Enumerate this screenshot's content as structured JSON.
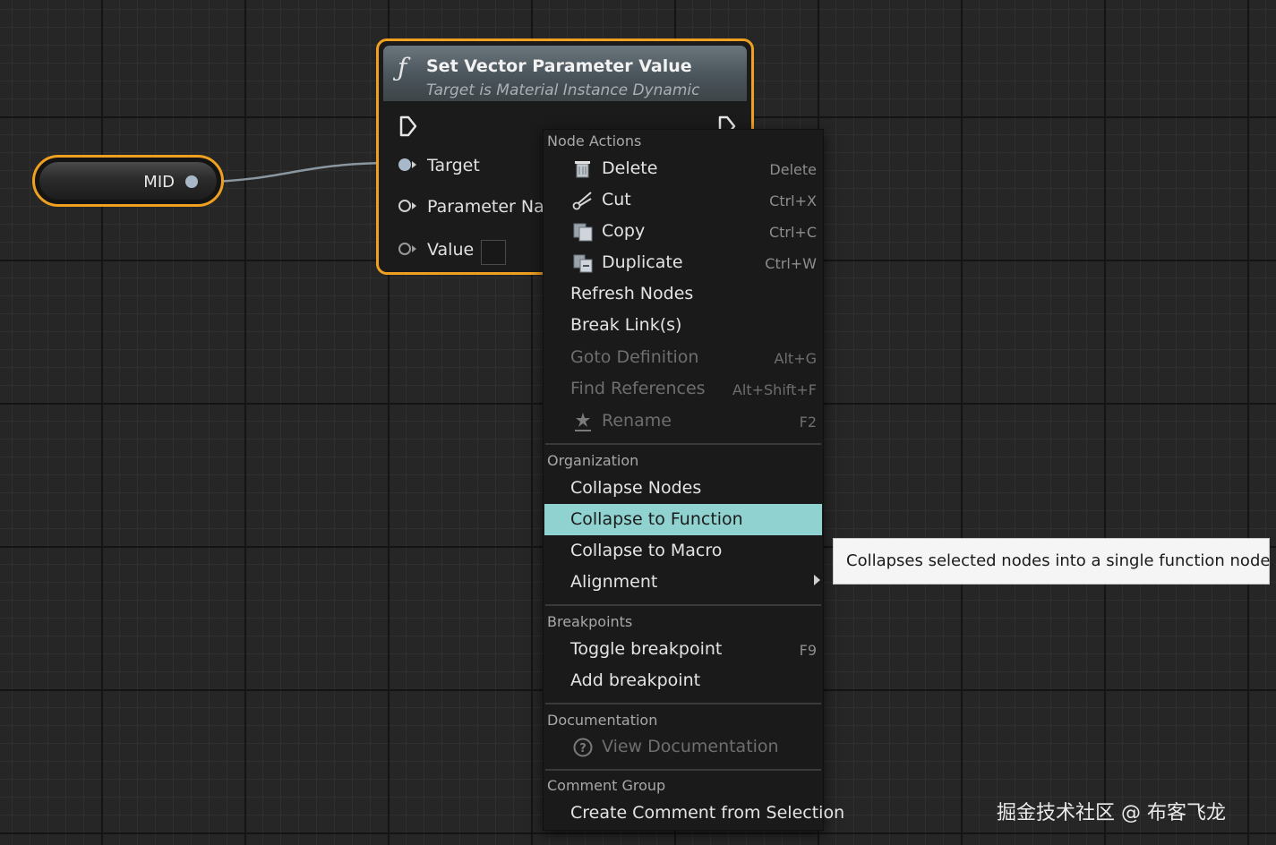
{
  "colors": {
    "selection_outline": "#f0a020",
    "menu_highlight": "#8fd2d0",
    "menu_background": "#1a1a1a",
    "tooltip_background": "#f5f5f5"
  },
  "mid_node": {
    "label": "MID"
  },
  "function_node": {
    "icon": "function-icon",
    "title": "Set Vector Parameter Value",
    "subtitle": "Target is Material Instance Dynamic",
    "pins": {
      "target": "Target",
      "parameter_name": "Parameter Nam",
      "value": "Value"
    }
  },
  "context_menu": {
    "node_actions": {
      "header": "Node Actions",
      "delete": {
        "label": "Delete",
        "shortcut": "Delete",
        "icon": "delete-icon"
      },
      "cut": {
        "label": "Cut",
        "shortcut": "Ctrl+X",
        "icon": "scissors-icon"
      },
      "copy": {
        "label": "Copy",
        "shortcut": "Ctrl+C",
        "icon": "copy-icon"
      },
      "duplicate": {
        "label": "Duplicate",
        "shortcut": "Ctrl+W",
        "icon": "duplicate-icon"
      },
      "refresh": {
        "label": "Refresh Nodes"
      },
      "break_links": {
        "label": "Break Link(s)"
      },
      "goto_definition": {
        "label": "Goto Definition",
        "shortcut": "Alt+G"
      },
      "find_references": {
        "label": "Find References",
        "shortcut": "Alt+Shift+F"
      },
      "rename": {
        "label": "Rename",
        "shortcut": "F2",
        "icon": "rename-icon"
      }
    },
    "organization": {
      "header": "Organization",
      "collapse_nodes": {
        "label": "Collapse Nodes"
      },
      "collapse_to_function": {
        "label": "Collapse to Function"
      },
      "collapse_to_macro": {
        "label": "Collapse to Macro"
      },
      "alignment": {
        "label": "Alignment"
      }
    },
    "breakpoints": {
      "header": "Breakpoints",
      "toggle": {
        "label": "Toggle breakpoint",
        "shortcut": "F9"
      },
      "add": {
        "label": "Add breakpoint"
      }
    },
    "documentation": {
      "header": "Documentation",
      "view": {
        "label": "View Documentation",
        "icon": "help-icon"
      }
    },
    "comment_group": {
      "header": "Comment Group",
      "create": {
        "label": "Create Comment from Selection"
      }
    }
  },
  "tooltip": {
    "text": "Collapses selected nodes into a single function node."
  },
  "watermark": {
    "text": "掘金技术社区 @ 布客飞龙"
  }
}
